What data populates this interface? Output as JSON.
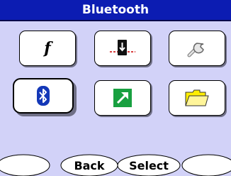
{
  "title": "Bluetooth",
  "grid": [
    {
      "icon": "function-icon",
      "glyph": "f"
    },
    {
      "icon": "install-phone-icon"
    },
    {
      "icon": "wrench-icon"
    },
    {
      "icon": "bluetooth-icon",
      "selected": true
    },
    {
      "icon": "shortcut-arrow-icon"
    },
    {
      "icon": "folder-icon"
    }
  ],
  "softkeys": {
    "left": "",
    "back": "Back",
    "select": "Select",
    "right": ""
  },
  "colors": {
    "background": "#d2d2f8",
    "titlebar": "#0c1cb2",
    "bluetooth": "#1438b8",
    "shortcut": "#18a040",
    "folder": "#ffee00"
  }
}
